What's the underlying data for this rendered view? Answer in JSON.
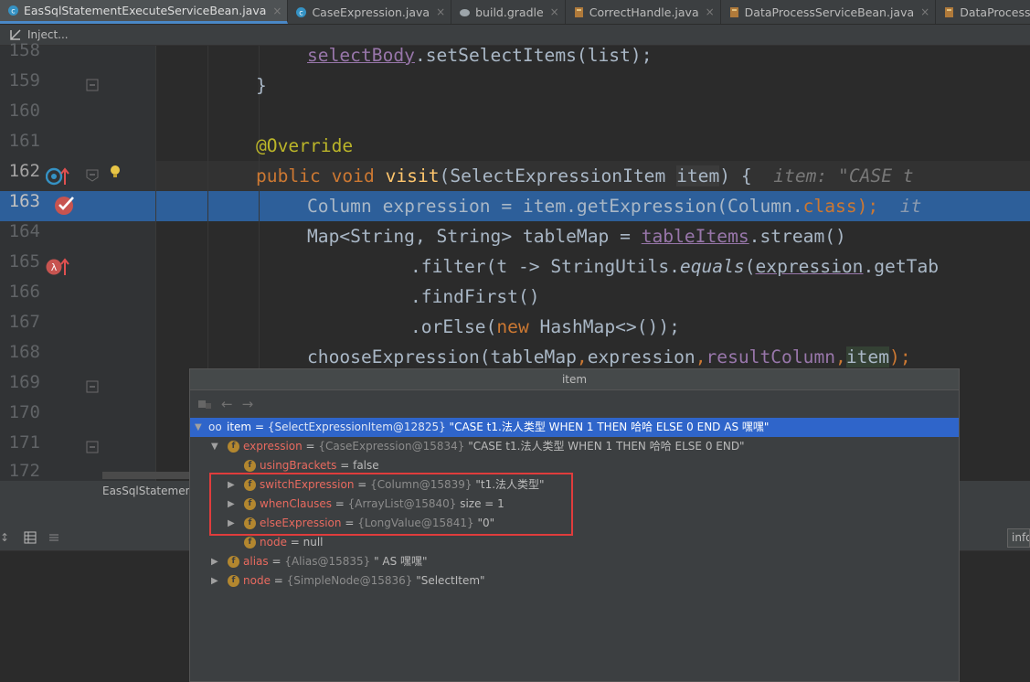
{
  "tabs": [
    {
      "label": "EasSqlStatementExecuteServiceBean.java",
      "active": true,
      "icon": "java-class-icon"
    },
    {
      "label": "CaseExpression.java",
      "active": false,
      "icon": "java-class-icon"
    },
    {
      "label": "build.gradle",
      "active": false,
      "icon": "gradle-icon"
    },
    {
      "label": "CorrectHandle.java",
      "active": false,
      "icon": "java-file-icon"
    },
    {
      "label": "DataProcessServiceBean.java",
      "active": false,
      "icon": "java-file-icon"
    },
    {
      "label": "DataProcessingType.java",
      "active": false,
      "icon": "java-file-icon"
    }
  ],
  "breadcrumb": {
    "label": "Inject..."
  },
  "line_numbers": [
    "158",
    "159",
    "160",
    "161",
    "162",
    "163",
    "164",
    "165",
    "166",
    "167",
    "168",
    "169",
    "170",
    "171",
    "172"
  ],
  "code": {
    "l158": {
      "a": "selectBody",
      "b": ".setSelectItems(list);"
    },
    "l159": "}",
    "l161": "@Override",
    "l162": {
      "kw1": "public",
      "kw2": "void",
      "fn": "visit",
      "params": "(SelectExpressionItem ",
      "item": "item",
      "close": ") {",
      "hint": "item: \"CASE t"
    },
    "l163": {
      "a": "Column expression = item.getExpression(Column.",
      "cls": "class",
      "b": ");",
      "hint": "it"
    },
    "l164": {
      "a": "Map<String, String> tableMap = ",
      "fld": "tableItems",
      "b": ".stream()"
    },
    "l165": {
      "a": ".filter(t -> StringUtils.",
      "it": "equals",
      "b": "(",
      "ul": "expression",
      "c": ".getTab"
    },
    "l166": ".findFirst()",
    "l167": {
      "a": ".orElse(",
      "kw": "new",
      "b": " HashMap<>());"
    },
    "l168": {
      "a": "chooseExpression(tableMap",
      "c1": ",",
      "b": "expression",
      "c2": ",",
      "fld": "resultColumn",
      "c3": ",",
      "item": "item",
      "d": ");"
    }
  },
  "debug_tab": {
    "label": "EasSqlStatement"
  },
  "info_field": {
    "value": "info"
  },
  "popup": {
    "title": "item",
    "rows": [
      {
        "name": "item",
        "eq": " = ",
        "ref": "{SelectExpressionItem@12825}",
        "val": " \"CASE t1.法人类型 WHEN 1 THEN 哈哈 ELSE 0 END AS 嘿嘿\"",
        "icon": "watch-icon",
        "expanded": true,
        "selected": true
      },
      {
        "name": "expression",
        "eq": " = ",
        "ref": "{CaseExpression@15834}",
        "val": " \"CASE t1.法人类型 WHEN 1 THEN 哈哈 ELSE 0 END\"",
        "icon": "f",
        "expanded": true
      },
      {
        "name": "usingBrackets",
        "eq": " = ",
        "ref": "",
        "val": "false",
        "icon": "f",
        "leaf": true
      },
      {
        "name": "switchExpression",
        "eq": " = ",
        "ref": "{Column@15839}",
        "val": " \"t1.法人类型\"",
        "icon": "f"
      },
      {
        "name": "whenClauses",
        "eq": " = ",
        "ref": "{ArrayList@15840}",
        "val": "  size = 1",
        "icon": "f"
      },
      {
        "name": "elseExpression",
        "eq": " = ",
        "ref": "{LongValue@15841}",
        "val": " \"0\"",
        "icon": "f"
      },
      {
        "name": "node",
        "eq": " = ",
        "ref": "",
        "val": "null",
        "icon": "f",
        "leaf": true
      },
      {
        "name": "alias",
        "eq": " = ",
        "ref": "{Alias@15835}",
        "val": " \" AS 嘿嘿\"",
        "icon": "f"
      },
      {
        "name": "node",
        "eq": " = ",
        "ref": "{SimpleNode@15836}",
        "val": " \"SelectItem\"",
        "icon": "f"
      }
    ]
  },
  "colors": {
    "accent": "#4a88c7",
    "selection": "#2f65ca",
    "breakpoint_line": "#2d5f9a",
    "highlight_box": "#e03c3c"
  }
}
